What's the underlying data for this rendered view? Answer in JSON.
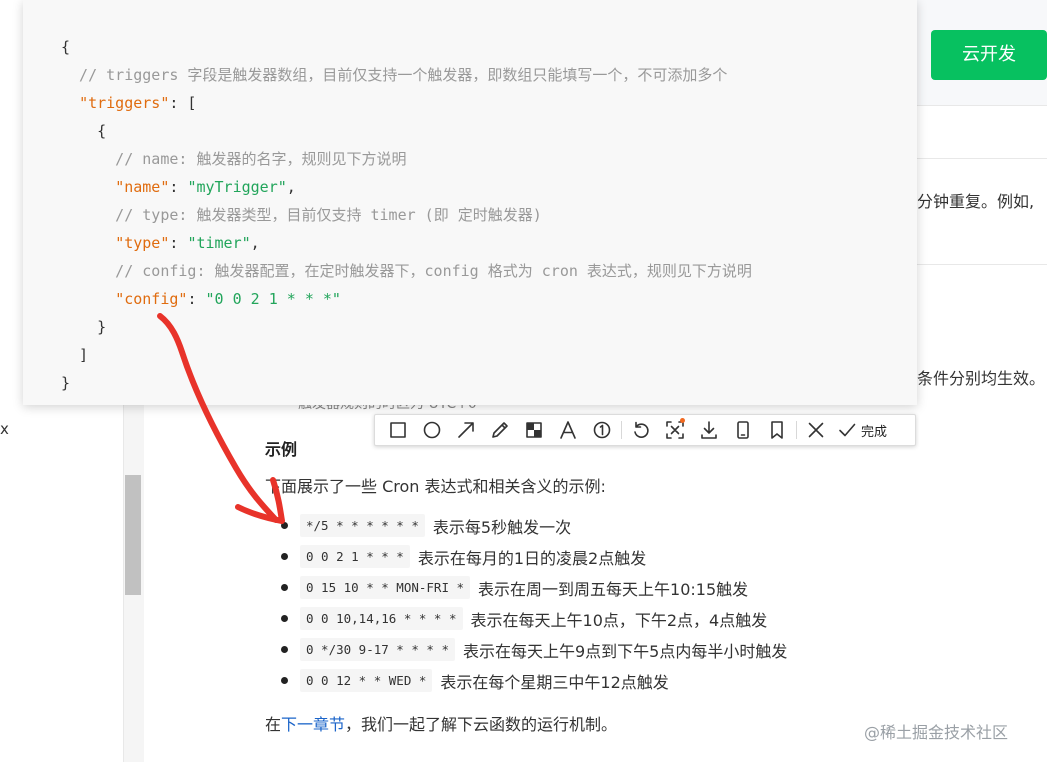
{
  "header": {
    "cloud_button_label": "云开发"
  },
  "right_fragments": {
    "line1": "分钟重复。例如,",
    "line2": "条件分别均生效。",
    "partial_hidden": "触发器规则的时区为 UTC+0"
  },
  "left_edge_char": "x",
  "code": {
    "lines": [
      [
        {
          "t": "{",
          "c": "punc"
        }
      ],
      [
        {
          "t": "  // triggers 字段是触发器数组，目前仅支持一个触发器，即数组只能填写一个，不可添加多个",
          "c": "comment"
        }
      ],
      [
        {
          "t": "  ",
          "c": "punc"
        },
        {
          "t": "\"triggers\"",
          "c": "key"
        },
        {
          "t": ": [",
          "c": "punc"
        }
      ],
      [
        {
          "t": "    {",
          "c": "punc"
        }
      ],
      [
        {
          "t": "      // name: 触发器的名字，规则见下方说明",
          "c": "comment"
        }
      ],
      [
        {
          "t": "      ",
          "c": "punc"
        },
        {
          "t": "\"name\"",
          "c": "key"
        },
        {
          "t": ": ",
          "c": "punc"
        },
        {
          "t": "\"myTrigger\"",
          "c": "str"
        },
        {
          "t": ",",
          "c": "punc"
        }
      ],
      [
        {
          "t": "      // type: 触发器类型，目前仅支持 timer (即 定时触发器)",
          "c": "comment"
        }
      ],
      [
        {
          "t": "      ",
          "c": "punc"
        },
        {
          "t": "\"type\"",
          "c": "key"
        },
        {
          "t": ": ",
          "c": "punc"
        },
        {
          "t": "\"timer\"",
          "c": "str"
        },
        {
          "t": ",",
          "c": "punc"
        }
      ],
      [
        {
          "t": "      // config: 触发器配置，在定时触发器下，config 格式为 cron 表达式，规则见下方说明",
          "c": "comment"
        }
      ],
      [
        {
          "t": "      ",
          "c": "punc"
        },
        {
          "t": "\"config\"",
          "c": "key"
        },
        {
          "t": ": ",
          "c": "punc"
        },
        {
          "t": "\"0 0 2 1 * * *\"",
          "c": "str"
        }
      ],
      [
        {
          "t": "    }",
          "c": "punc"
        }
      ],
      [
        {
          "t": "  ]",
          "c": "punc"
        }
      ],
      [
        {
          "t": "}",
          "c": "punc"
        }
      ]
    ]
  },
  "toolbar": {
    "tools": [
      {
        "name": "rectangle-tool",
        "icon": "rect"
      },
      {
        "name": "ellipse-tool",
        "icon": "circle"
      },
      {
        "name": "arrow-tool",
        "icon": "arrow"
      },
      {
        "name": "pen-tool",
        "icon": "pen"
      },
      {
        "name": "mosaic-tool",
        "icon": "mosaic"
      },
      {
        "name": "text-tool",
        "icon": "text"
      },
      {
        "name": "number-tool",
        "icon": "number"
      },
      {
        "sep": true
      },
      {
        "name": "undo-tool",
        "icon": "undo"
      },
      {
        "name": "ocr-tool",
        "icon": "ocr",
        "dot": true
      },
      {
        "name": "download-tool",
        "icon": "download"
      },
      {
        "name": "pin-tool",
        "icon": "pin"
      },
      {
        "name": "bookmark-tool",
        "icon": "bookmark"
      },
      {
        "sep": true
      },
      {
        "name": "close-tool",
        "icon": "close"
      }
    ],
    "done_label": "完成"
  },
  "article": {
    "heading": "示例",
    "intro": "下面展示了一些 Cron 表达式和相关含义的示例:",
    "examples": [
      {
        "code": "*/5 * * * * * *",
        "desc": "表示每5秒触发一次"
      },
      {
        "code": "0 0 2 1 * * *",
        "desc": "表示在每月的1日的凌晨2点触发"
      },
      {
        "code": "0 15 10 * * MON-FRI *",
        "desc": "表示在周一到周五每天上午10:15触发"
      },
      {
        "code": "0 0 10,14,16 * * * *",
        "desc": "表示在每天上午10点，下午2点，4点触发"
      },
      {
        "code": "0 */30 9-17 * * * *",
        "desc": "表示在每天上午9点到下午5点内每半小时触发"
      },
      {
        "code": "0 0 12 * * WED *",
        "desc": "表示在每个星期三中午12点触发"
      }
    ],
    "next_prefix": "在",
    "next_link": "下一章节",
    "next_suffix": "，我们一起了解下云函数的运行机制。"
  },
  "watermark": "@稀土掘金技术社区",
  "colors": {
    "accent_green": "#07c160",
    "annotation_red": "#e8332a",
    "link_blue": "#1b64c9",
    "code_key": "#e06c0f",
    "code_string": "#22a55b",
    "code_comment": "#999999"
  }
}
